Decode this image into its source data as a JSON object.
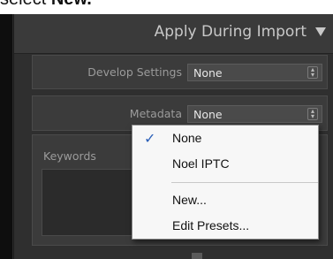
{
  "caption": {
    "prefix": "select ",
    "emphasis": "New."
  },
  "panel": {
    "title": "Apply During Import"
  },
  "develop_settings": {
    "label": "Develop Settings",
    "value": "None"
  },
  "metadata": {
    "label": "Metadata",
    "value": "None"
  },
  "keywords": {
    "label": "Keywords"
  },
  "menu": {
    "items": [
      "None",
      "Noel IPTC",
      "New...",
      "Edit Presets..."
    ],
    "checked_index": 0,
    "check_glyph": "✓"
  },
  "colors": {
    "checkmark": "#2a5fb8",
    "panel_bg": "#2f2f2f",
    "menu_bg": "#f7f7f7"
  }
}
